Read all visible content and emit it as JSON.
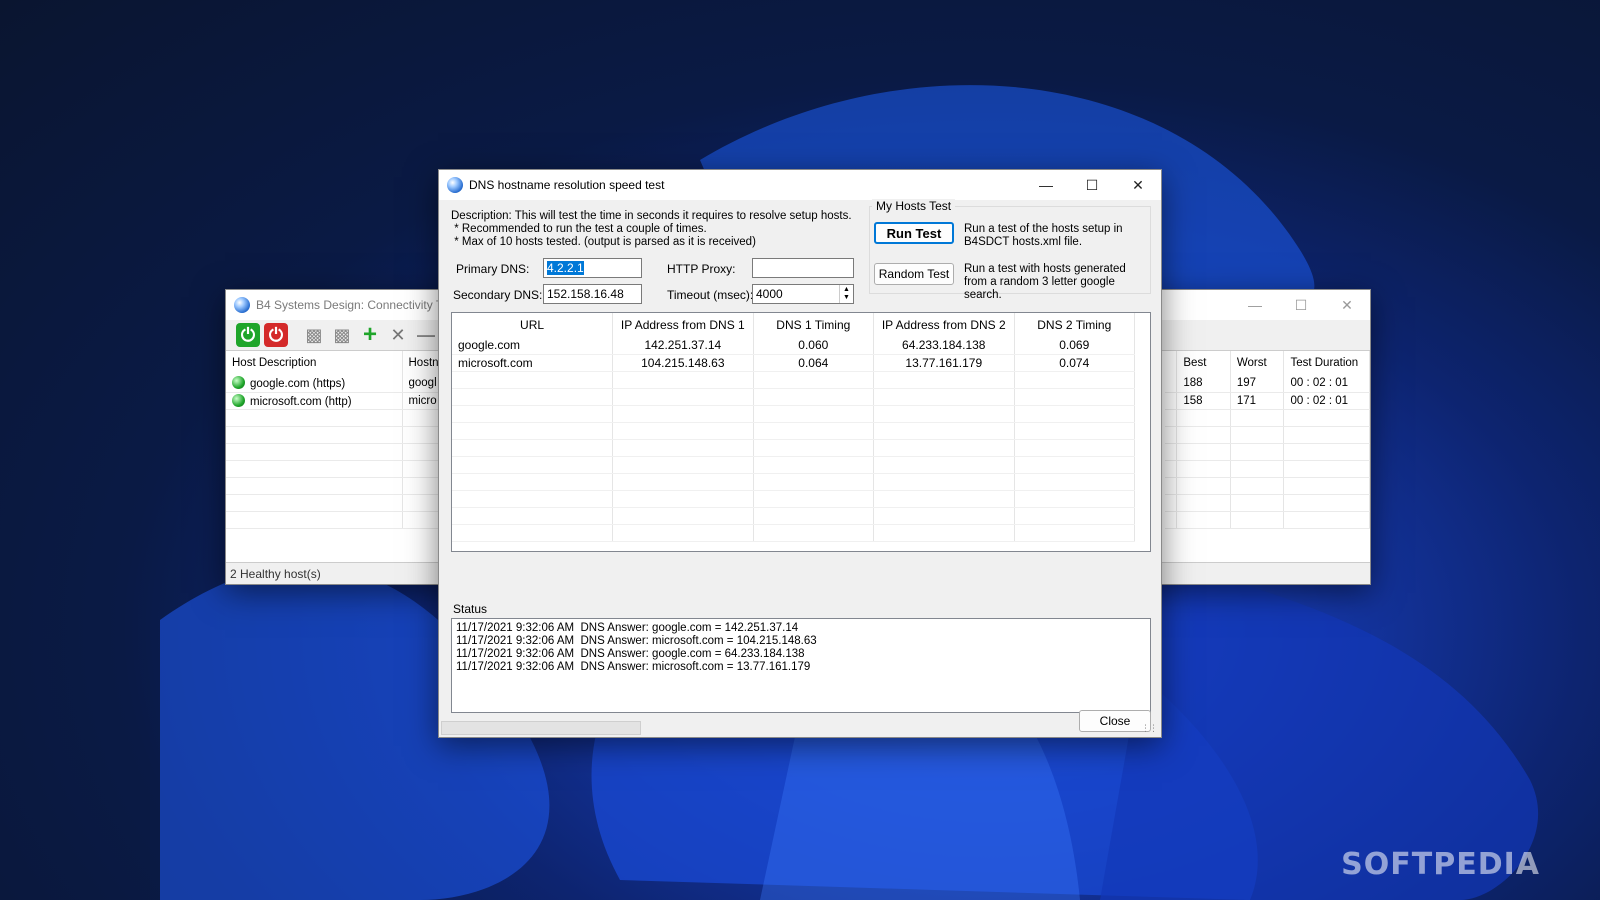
{
  "background_window": {
    "title": "B4 Systems Design:  Connectivity T",
    "toolbar": [
      "start-icon",
      "stop-icon",
      "hosts-icon",
      "hosts2-icon",
      "add-icon",
      "tools-icon",
      "remove-icon"
    ],
    "columns": [
      "Host Description",
      "Hostn",
      "",
      "Best",
      "Worst",
      "Test Duration"
    ],
    "rows": [
      {
        "description": "google.com (https)",
        "host": "googl",
        "best": "188",
        "worst": "197",
        "duration": "00 : 02 : 01"
      },
      {
        "description": "microsoft.com (http)",
        "host": "micro",
        "best": "158",
        "worst": "171",
        "duration": "00 : 02 : 01"
      }
    ],
    "status": "2 Healthy host(s)"
  },
  "dialog": {
    "title": "DNS hostname resolution speed test",
    "description_lines": [
      "Description: This will test the time in seconds it requires to resolve setup hosts.",
      " * Recommended to run the test a couple of times.",
      " * Max of 10 hosts tested. (output is parsed as it is received)"
    ],
    "primary_dns_label": "Primary DNS:",
    "primary_dns_value": "4.2.2.1",
    "secondary_dns_label": "Secondary DNS:",
    "secondary_dns_value": "152.158.16.48",
    "http_proxy_label": "HTTP Proxy:",
    "http_proxy_value": "",
    "timeout_label": "Timeout (msec):",
    "timeout_value": "4000",
    "my_hosts_group": "My Hosts Test",
    "run_test_label": "Run Test",
    "run_test_desc": "Run a test of the hosts setup in B4SDCT hosts.xml file.",
    "random_test_label": "Random Test",
    "random_test_desc": "Run a test with hosts generated from a random 3 letter google search.",
    "columns": [
      "URL",
      "IP Address from DNS 1",
      "DNS 1 Timing",
      "IP Address from DNS 2",
      "DNS 2 Timing"
    ],
    "rows": [
      {
        "url": "google.com",
        "ip1": "142.251.37.14",
        "t1": "0.060",
        "ip2": "64.233.184.138",
        "t2": "0.069"
      },
      {
        "url": "microsoft.com",
        "ip1": "104.215.148.63",
        "t1": "0.064",
        "ip2": "13.77.161.179",
        "t2": "0.074"
      }
    ],
    "status_label": "Status",
    "status_lines": [
      "11/17/2021 9:32:06 AM  DNS Answer: google.com = 142.251.37.14",
      "11/17/2021 9:32:06 AM  DNS Answer: microsoft.com = 104.215.148.63",
      "11/17/2021 9:32:06 AM  DNS Answer: google.com = 64.233.184.138",
      "11/17/2021 9:32:06 AM  DNS Answer: microsoft.com = 13.77.161.179"
    ],
    "close_label": "Close"
  },
  "watermark": "SOFTPEDIA"
}
